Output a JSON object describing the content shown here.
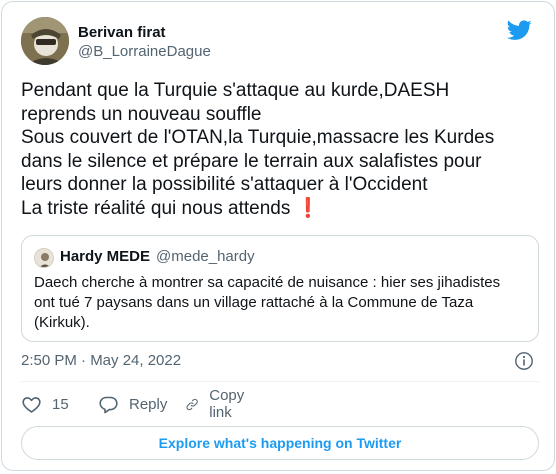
{
  "author": {
    "name": "Berivan firat",
    "handle": "@B_LorraineDague"
  },
  "tweet": {
    "lines": [
      "Pendant que la Turquie s'attaque au kurde,DAESH",
      "reprends un nouveau souffle",
      "Sous couvert de l'OTAN,la Turquie,massacre les Kurdes",
      "dans le silence et prépare le terrain aux salafistes pour",
      "leurs donner la possibilité s'attaquer à l'Occident",
      "La triste réalité qui nous  attends"
    ],
    "emoji": "❗"
  },
  "quote": {
    "name": "Hardy MEDE",
    "handle": "@mede_hardy",
    "lines": [
      "Daech cherche à montrer sa capacité de nuisance : hier ses jihadistes",
      "ont tué 7 paysans dans un village rattaché à la Commune de Taza",
      "(Kirkuk)."
    ]
  },
  "meta": {
    "timestamp": "2:50 PM · May 24, 2022"
  },
  "actions": {
    "likes": "15",
    "reply_label": "Reply",
    "copy_label": "Copy link"
  },
  "explore_label": "Explore what's happening on Twitter",
  "colors": {
    "accent": "#1d9bf0",
    "text": "#0f1419",
    "muted": "#536471",
    "border": "#cfd9de",
    "alert": "#dd2e44"
  },
  "icons": [
    "avatar-image",
    "twitter-bird-icon",
    "info-icon",
    "heart-icon",
    "reply-bubble-icon",
    "link-icon"
  ]
}
